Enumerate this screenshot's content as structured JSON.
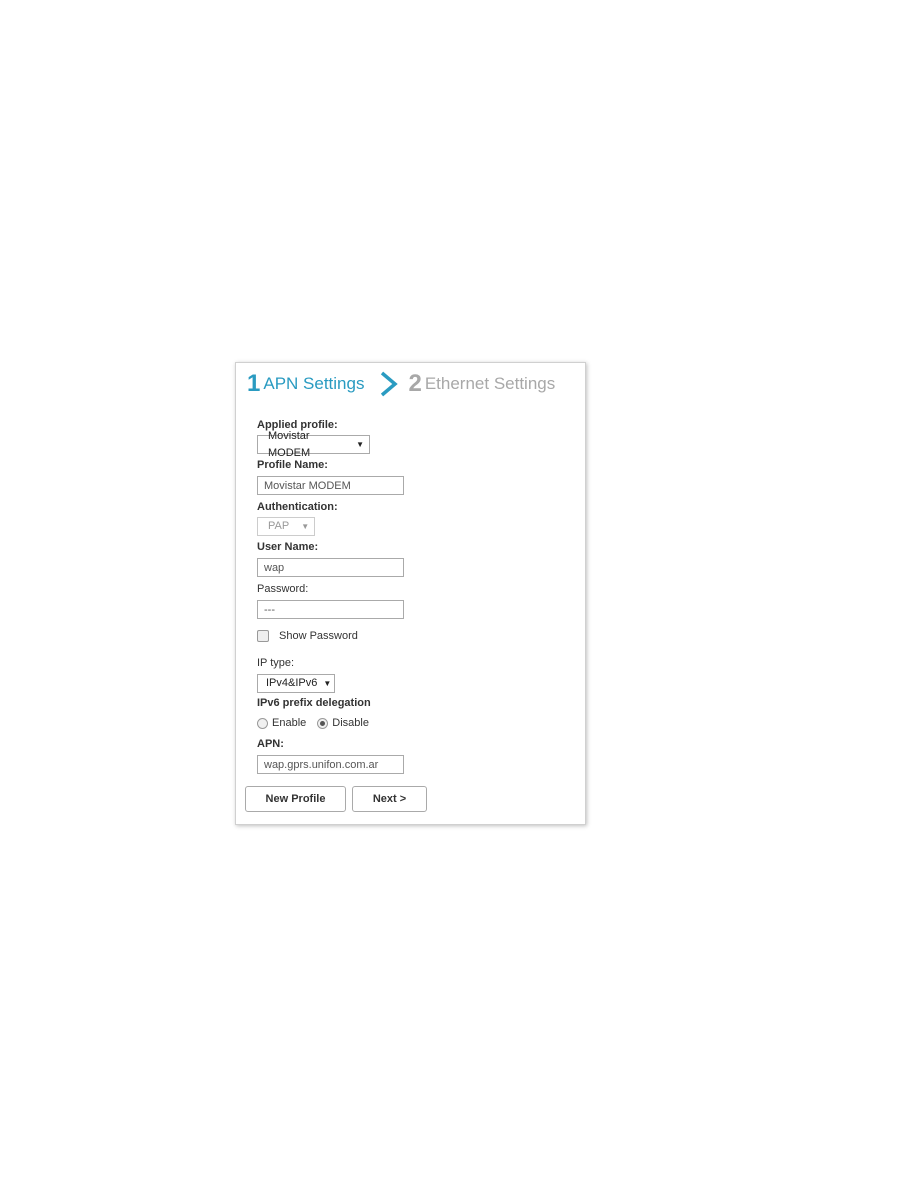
{
  "steps": [
    {
      "number": "1",
      "label": "APN Settings",
      "active": true
    },
    {
      "number": "2",
      "label": "Ethernet Settings",
      "active": false
    }
  ],
  "colors": {
    "active_step": "#2a9bc1",
    "inactive_step": "#a8a8a8"
  },
  "form": {
    "applied_profile_label": "Applied profile:",
    "applied_profile_value": "Movistar MODEM",
    "profile_name_label": "Profile Name:",
    "profile_name_value": "Movistar MODEM",
    "authentication_label": "Authentication:",
    "authentication_value": "PAP",
    "user_name_label": "User Name:",
    "user_name_value": "wap",
    "password_label": "Password:",
    "password_value": "---",
    "show_password_label": "Show Password",
    "show_password_checked": false,
    "ip_type_label": "IP type:",
    "ip_type_value": "IPv4&IPv6",
    "ipv6_prefix_label": "IPv6 prefix delegation",
    "enable_label": "Enable",
    "disable_label": "Disable",
    "ipv6_prefix_selected": "Disable",
    "apn_label": "APN:",
    "apn_value": "wap.gprs.unifon.com.ar"
  },
  "buttons": {
    "new_profile": "New Profile",
    "next": "Next >"
  },
  "icons": {
    "dropdown": "▼",
    "step_separator": "chevron-right-icon"
  }
}
